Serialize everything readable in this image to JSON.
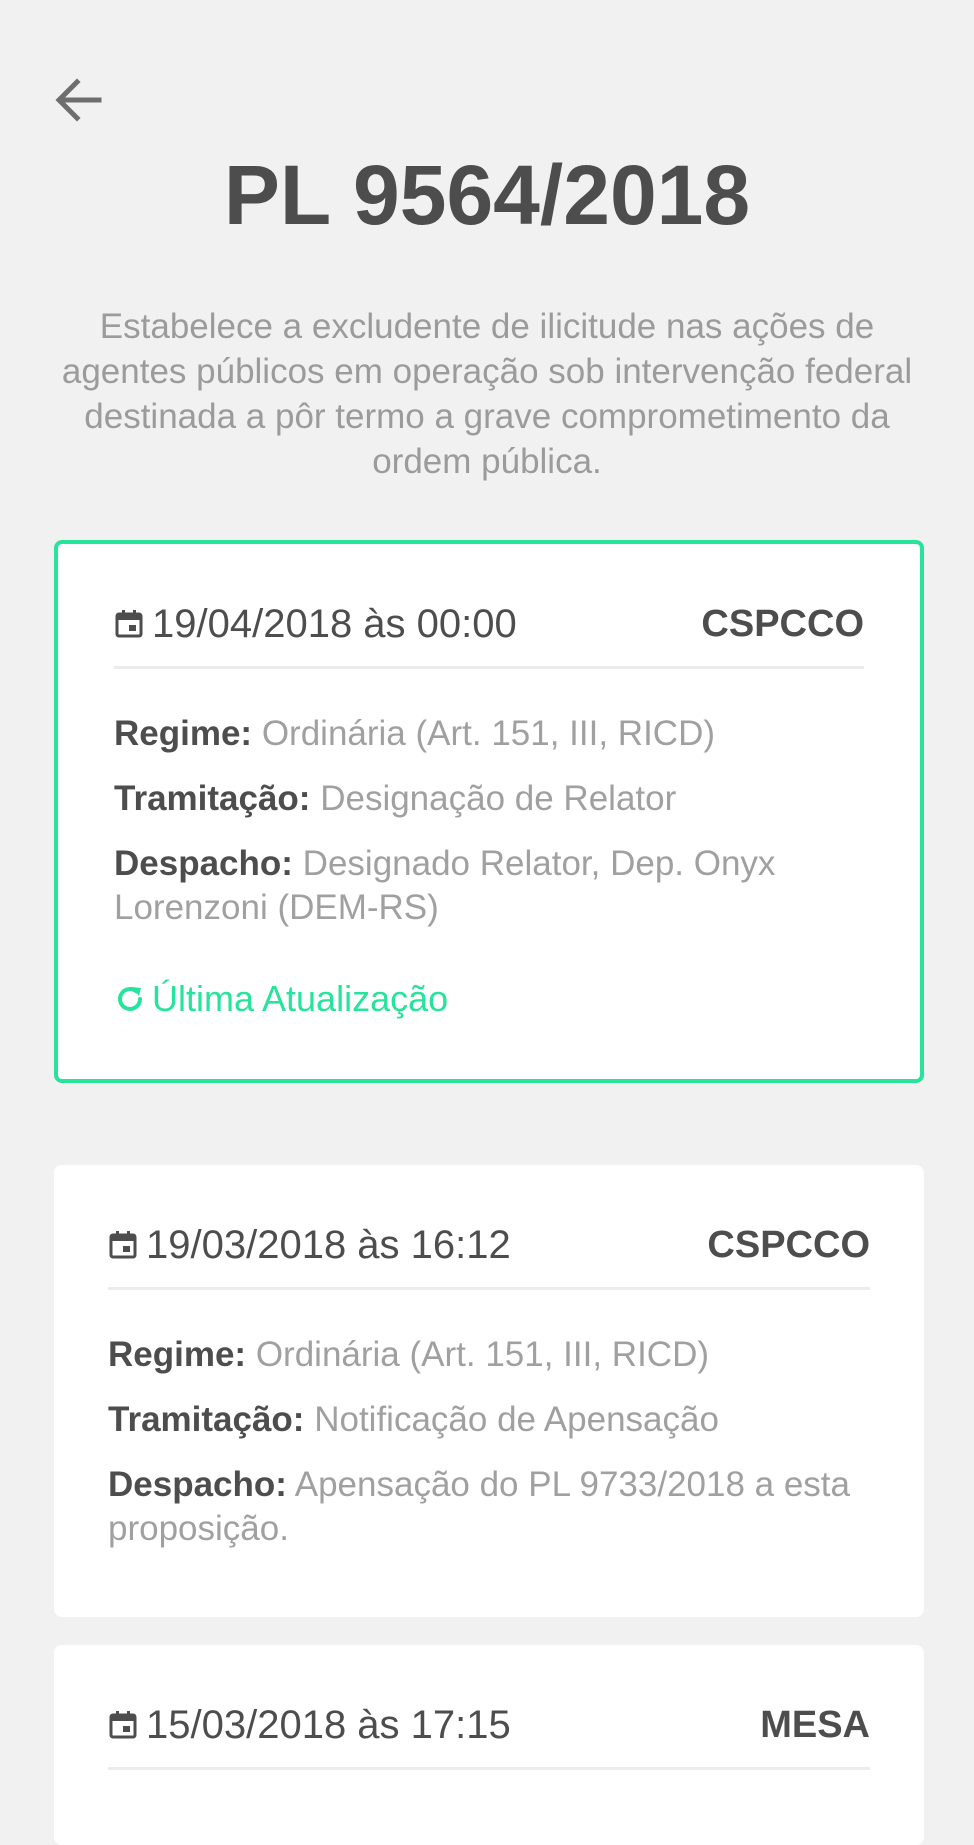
{
  "header": {
    "back_icon": "arrow-left-icon",
    "title": "PL 9564/2018",
    "description": "Estabelece a excludente de ilicitude nas ações de agentes públicos em operação sob intervenção federal destinada a pôr termo a grave comprometimento da ordem pública."
  },
  "theme": {
    "accent": "#27e39b",
    "text_dark": "#4d4d4d",
    "text_muted": "#9b9b9b",
    "background": "#f1f1f1"
  },
  "labels": {
    "regime": "Regime:",
    "tramitacao": "Tramitação:",
    "despacho": "Despacho:"
  },
  "events": [
    {
      "date": "19/04/2018 às 00:00",
      "org": "CSPCCO",
      "regime": "Ordinária (Art. 151, III, RICD)",
      "tramitacao": "Designação de Relator",
      "despacho": "Designado Relator, Dep. Onyx Lorenzoni (DEM-RS)",
      "update_label": "Última Atualização",
      "active": true
    },
    {
      "date": "19/03/2018 às 16:12",
      "org": "CSPCCO",
      "regime": "Ordinária (Art. 151, III, RICD)",
      "tramitacao": "Notificação de Apensação",
      "despacho": "Apensação do PL 9733/2018 a esta proposição.",
      "active": false
    },
    {
      "date": "15/03/2018 às 17:15",
      "org": "MESA",
      "active": false
    }
  ]
}
